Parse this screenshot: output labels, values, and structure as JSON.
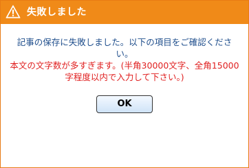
{
  "dialog": {
    "title": "失敗しました",
    "icon": "warning-icon",
    "accent_color": "#f08a18",
    "message_primary": "記事の保存に失敗しました。以下の項目をご確認ください。",
    "message_error": "本文の文字数が多すぎます。(半角30000文字、全角15000字程度以内で入力して下さい。)",
    "ok_label": "OK"
  }
}
